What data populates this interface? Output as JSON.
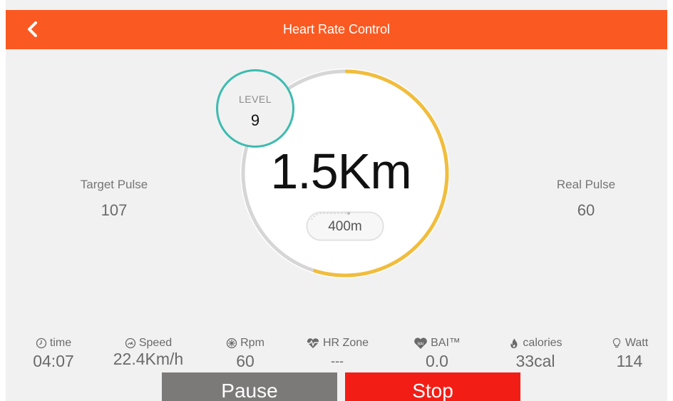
{
  "header": {
    "title": "Heart Rate Control"
  },
  "target_pulse": {
    "label": "Target Pulse",
    "value": "107"
  },
  "real_pulse": {
    "label": "Real Pulse",
    "value": "60"
  },
  "center": {
    "distance": "1.5Km",
    "lap": "400m",
    "progress_fraction": 0.55,
    "level_label": "LEVEL",
    "level_value": "9"
  },
  "stats": [
    {
      "label": "time",
      "value": "04:07",
      "icon": "clock-icon"
    },
    {
      "label": "Speed",
      "value": "22.4Km/h",
      "icon": "speed-icon"
    },
    {
      "label": "Rpm",
      "value": "60",
      "icon": "rpm-icon"
    },
    {
      "label": "HR Zone",
      "value": "---",
      "icon": "heartbeat-icon"
    },
    {
      "label": "BAI™",
      "value": "0.0",
      "icon": "bai-heart-icon",
      "icon_text": "BAI"
    },
    {
      "label": "calories",
      "value": "33cal",
      "icon": "flame-icon"
    },
    {
      "label": "Watt",
      "value": "114",
      "icon": "bulb-icon"
    }
  ],
  "buttons": {
    "pause": "Pause",
    "stop": "Stop"
  },
  "colors": {
    "header": "#fa5a22",
    "ring_progress": "#f1bd3c",
    "ring_track": "#d6d6d6",
    "level_ring": "#3dbbb0",
    "pause": "#7c7a79",
    "stop": "#f21e16"
  }
}
